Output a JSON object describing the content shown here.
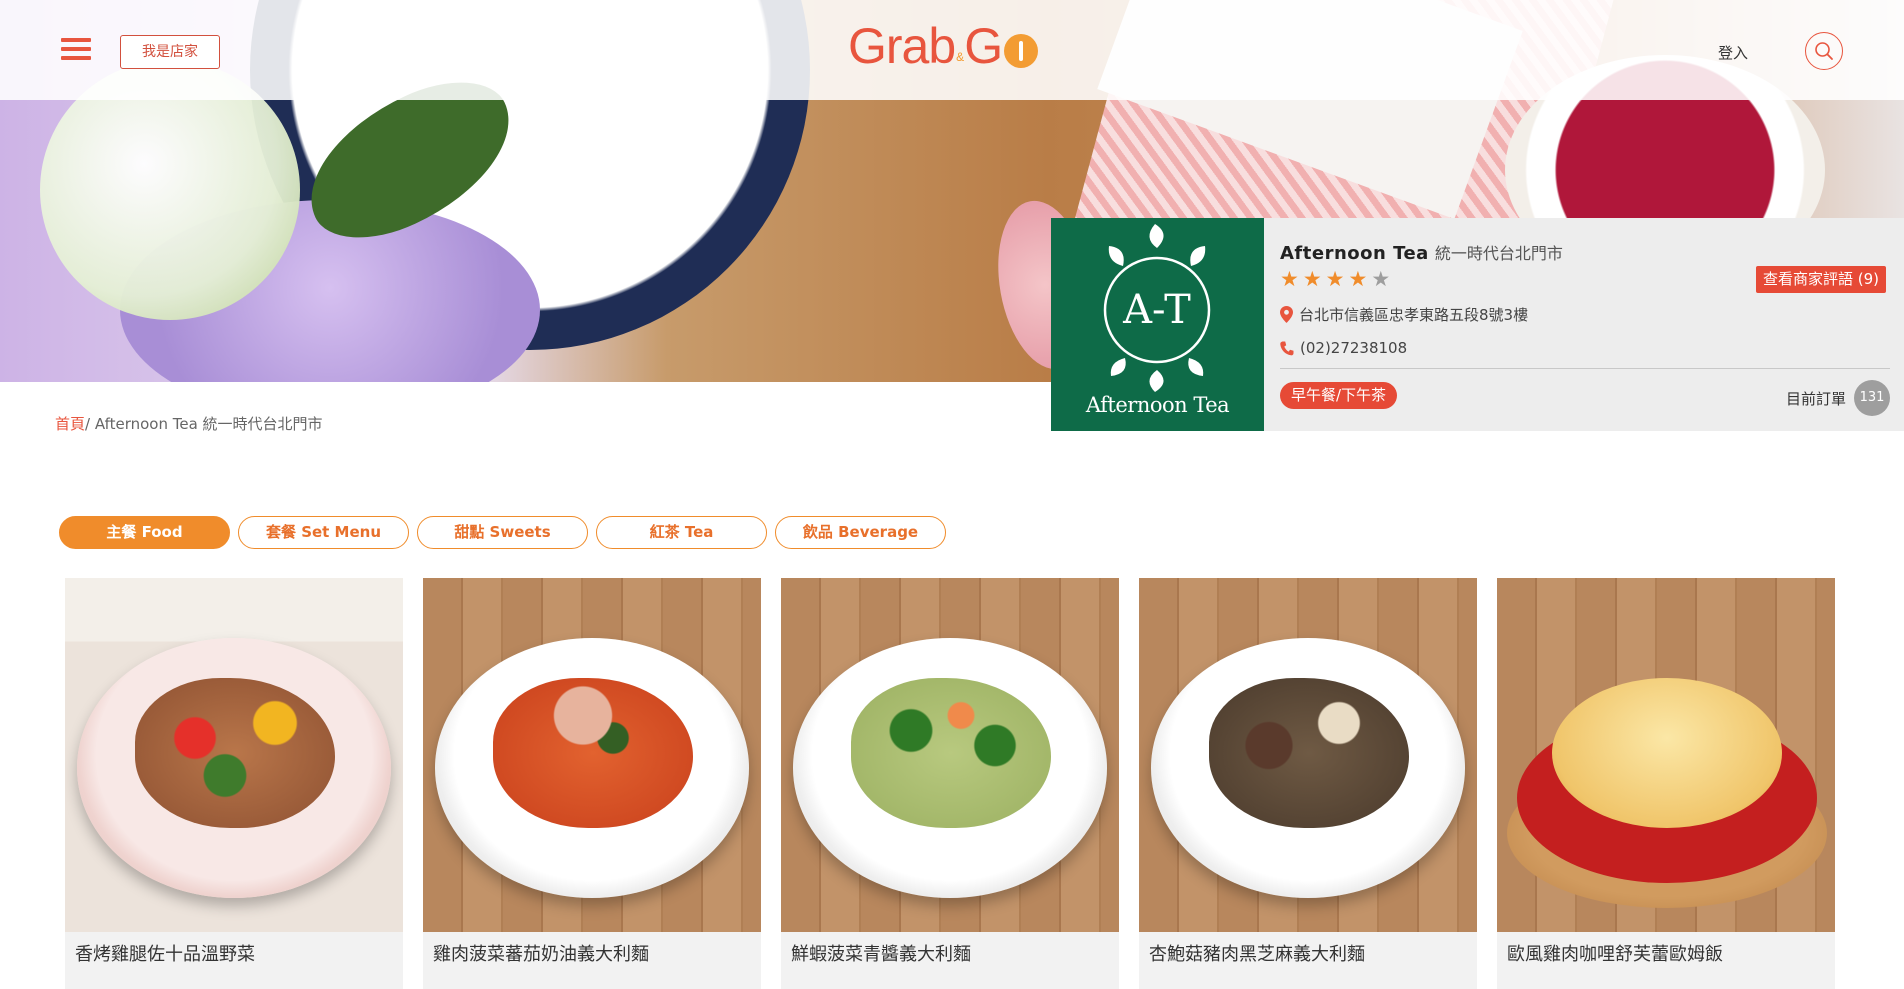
{
  "header": {
    "store_button": "我是店家",
    "logo_text_grab": "Grab",
    "logo_amp": "&",
    "logo_text_g": "G",
    "login": "登入"
  },
  "store": {
    "name": "Afternoon Tea",
    "branch": "統一時代台北門市",
    "logo_text": "Afternoon Tea",
    "logo_monogram": "A-T",
    "rating": 4,
    "max_rating": 5,
    "review_button": "查看商家評語 (9)",
    "address": "台北市信義區忠孝東路五段8號3樓",
    "phone": "(02)27238108",
    "category": "早午餐/下午茶",
    "orders_label": "目前訂單",
    "orders_count": "131"
  },
  "breadcrumb": {
    "home": "首頁",
    "current": "/ Afternoon Tea  統一時代台北門市"
  },
  "tabs": [
    {
      "label": "主餐 Food",
      "active": true
    },
    {
      "label": "套餐 Set Menu",
      "active": false
    },
    {
      "label": "甜點 Sweets",
      "active": false
    },
    {
      "label": "紅茶 Tea",
      "active": false
    },
    {
      "label": "飲品 Beverage",
      "active": false
    }
  ],
  "products": [
    {
      "name": "香烤雞腿佐十品溫野菜"
    },
    {
      "name": "雞肉菠菜蕃茄奶油義大利麵"
    },
    {
      "name": "鮮蝦菠菜青醬義大利麵"
    },
    {
      "name": "杏鮑菇豬肉黑芝麻義大利麵"
    },
    {
      "name": "歐風雞肉咖哩舒芙蕾歐姆飯"
    }
  ],
  "colors": {
    "brand_red": "#e8553e",
    "brand_orange": "#f08c2b",
    "store_green": "#0e6b48",
    "star_filled": "#f08c2b",
    "star_empty": "#9e9e9e"
  }
}
